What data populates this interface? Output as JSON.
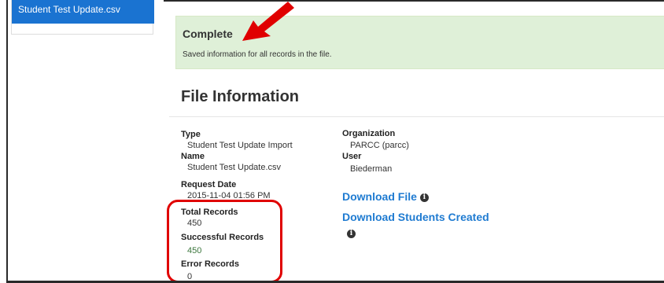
{
  "sidebar": {
    "items": [
      {
        "label": "Student Test Update.csv"
      }
    ]
  },
  "alert": {
    "title": "Complete",
    "message": "Saved information for all records in the file."
  },
  "section": {
    "title": "File Information"
  },
  "fields": {
    "type_label": "Type",
    "type_value": "Student Test Update Import",
    "name_label": "Name",
    "name_value": "Student Test Update.csv",
    "request_date_label": "Request Date",
    "request_date_value": "2015-11-04 01:56 PM",
    "total_label": "Total Records",
    "total_value": "450",
    "successful_label": "Successful Records",
    "successful_value": "450",
    "error_label": "Error Records",
    "error_value": "0",
    "org_label": "Organization",
    "org_value": "PARCC (parcc)",
    "user_label": "User",
    "user_value": "Biederman"
  },
  "links": {
    "download_file": "Download File",
    "download_students": "Download Students Created"
  },
  "icons": {
    "info": "info-icon",
    "arrow": "red-arrow-annotation"
  },
  "colors": {
    "accent": "#1f7bd1",
    "sidebar_active": "#1a73d1",
    "success_bg": "#dff0d8",
    "annotation": "#e00000",
    "success_text": "#3c763d"
  }
}
